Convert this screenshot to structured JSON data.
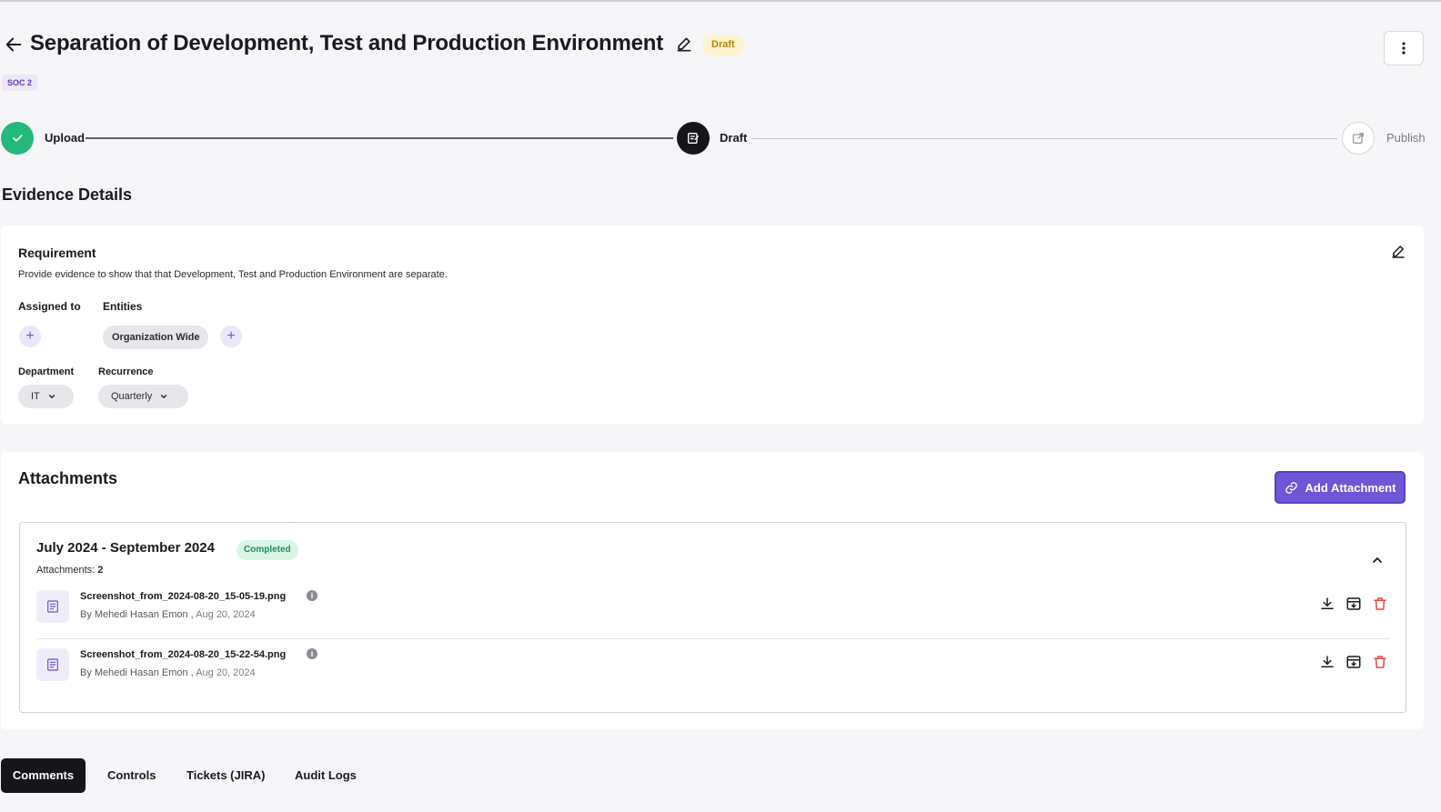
{
  "header": {
    "title": "Separation of Development, Test and Production Environment",
    "status_badge": "Draft",
    "framework_tag": "SOC 2"
  },
  "stepper": {
    "steps": [
      {
        "label": "Upload",
        "state": "completed"
      },
      {
        "label": "Draft",
        "state": "current"
      },
      {
        "label": "Publish",
        "state": "pending"
      }
    ]
  },
  "evidence": {
    "section_title": "Evidence Details",
    "requirement_title": "Requirement",
    "requirement_text": "Provide evidence to show that that Development, Test and Production Environment are separate.",
    "assigned_to_label": "Assigned to",
    "entities_label": "Entities",
    "entities": [
      "Organization Wide"
    ],
    "department_label": "Department",
    "department_value": "IT",
    "recurrence_label": "Recurrence",
    "recurrence_value": "Quarterly"
  },
  "attachments": {
    "section_title": "Attachments",
    "add_button_label": "Add Attachment",
    "period": {
      "title": "July 2024 - September 2024",
      "status": "Completed",
      "count_label": "Attachments:",
      "count": "2"
    },
    "files": [
      {
        "name": "Screenshot_from_2024-08-20_15-05-19.png",
        "by": "By Mehedi Hasan Emon ,",
        "date": "Aug 20, 2024"
      },
      {
        "name": "Screenshot_from_2024-08-20_15-22-54.png",
        "by": "By Mehedi Hasan Emon ,",
        "date": "Aug 20, 2024"
      }
    ]
  },
  "tabs": [
    "Comments",
    "Controls",
    "Tickets (JIRA)",
    "Audit Logs"
  ],
  "colors": {
    "accent": "#6f56d6",
    "success": "#22b97a",
    "danger": "#e5483f",
    "draft_badge": "#fdf3cf"
  }
}
